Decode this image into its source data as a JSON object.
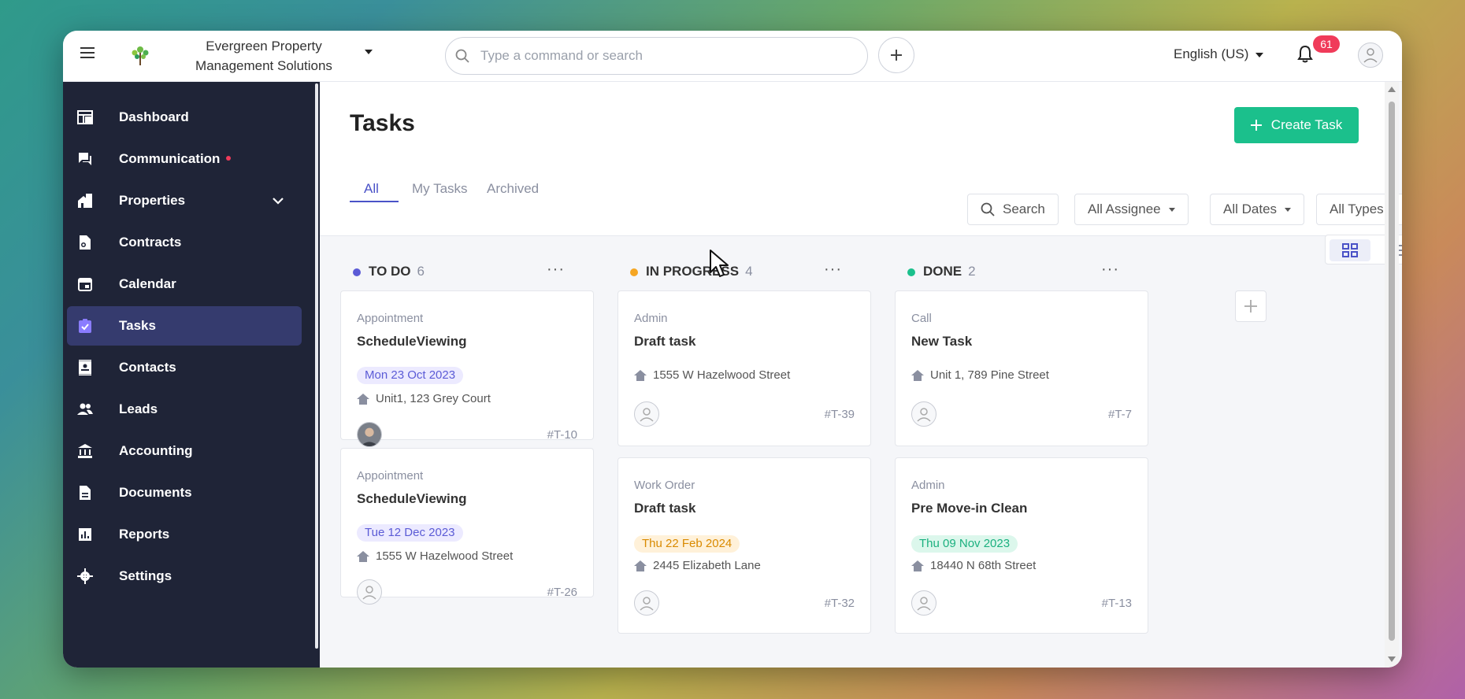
{
  "topbar": {
    "org_name": "Evergreen Property Management Solutions",
    "search_placeholder": "Type a command or search",
    "language": "English (US)",
    "notification_count": "61"
  },
  "sidebar": {
    "items": [
      {
        "label": "Dashboard",
        "icon": "dashboard-icon"
      },
      {
        "label": "Communication",
        "icon": "chat-icon"
      },
      {
        "label": "Properties",
        "icon": "building-icon"
      },
      {
        "label": "Contracts",
        "icon": "contract-icon"
      },
      {
        "label": "Calendar",
        "icon": "calendar-icon"
      },
      {
        "label": "Tasks",
        "icon": "tasks-icon"
      },
      {
        "label": "Contacts",
        "icon": "contact-card-icon"
      },
      {
        "label": "Leads",
        "icon": "people-icon"
      },
      {
        "label": "Accounting",
        "icon": "bank-icon"
      },
      {
        "label": "Documents",
        "icon": "document-icon"
      },
      {
        "label": "Reports",
        "icon": "chart-icon"
      },
      {
        "label": "Settings",
        "icon": "gear-icon"
      }
    ],
    "active": "Tasks"
  },
  "page": {
    "title": "Tasks",
    "create_label": "Create Task",
    "tabs": [
      "All",
      "My Tasks",
      "Archived"
    ],
    "active_tab": "All",
    "filters": {
      "search": "Search",
      "assignee": "All Assignee",
      "dates": "All Dates",
      "types": "All Types"
    }
  },
  "board": {
    "columns": [
      {
        "name": "TO DO",
        "count": "6",
        "color": "#5b5bd6",
        "cards": [
          {
            "type": "Appointment",
            "title": "ScheduleViewing",
            "date": "Mon 23 Oct 2023",
            "address": "Unit1, 123 Grey Court",
            "id": "#T-10"
          },
          {
            "type": "Appointment",
            "title": "ScheduleViewing",
            "date": "Tue 12 Dec 2023",
            "address": "1555 W Hazelwood Street",
            "id": "#T-26"
          }
        ]
      },
      {
        "name": "IN PROGRESS",
        "count": "4",
        "color": "#f5a623",
        "cards": [
          {
            "type": "Admin",
            "title": "Draft task",
            "address": "1555 W Hazelwood Street",
            "id": "#T-39"
          },
          {
            "type": "Work Order",
            "title": "Draft task",
            "date": "Thu 22 Feb 2024",
            "address": "2445 Elizabeth Lane",
            "id": "#T-32"
          }
        ]
      },
      {
        "name": "DONE",
        "count": "2",
        "color": "#1bc08c",
        "cards": [
          {
            "type": "Call",
            "title": "New Task",
            "address": "Unit 1, 789 Pine Street",
            "id": "#T-7"
          },
          {
            "type": "Admin",
            "title": "Pre Move-in Clean",
            "date": "Thu 09 Nov 2023",
            "address": "18440 N 68th Street",
            "id": "#T-13"
          }
        ]
      }
    ]
  }
}
